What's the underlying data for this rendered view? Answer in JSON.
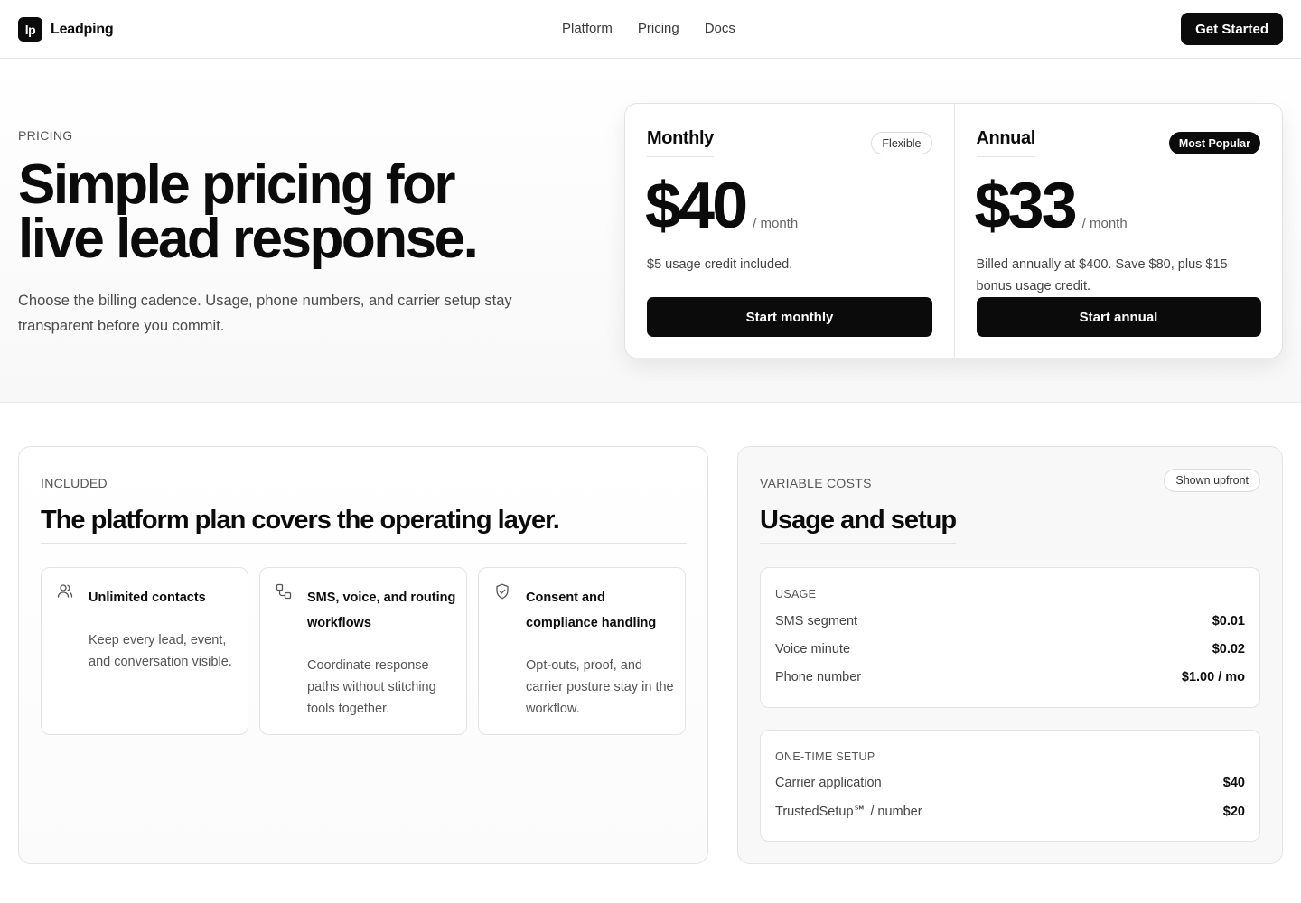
{
  "brand": {
    "logo_mark": "lp",
    "name": "Leadping"
  },
  "nav": {
    "items": [
      "Platform",
      "Pricing",
      "Docs"
    ],
    "cta": "Get Started"
  },
  "hero": {
    "eyebrow": "PRICING",
    "title_line1": "Simple pricing for",
    "title_line2": "live lead response.",
    "subtitle": "Choose the billing cadence. Usage, phone numbers, and carrier setup stay transparent before you commit."
  },
  "plans": [
    {
      "name": "Monthly",
      "badge": "Flexible",
      "price": "$40",
      "period": "/ month",
      "note": "$5 usage credit included.",
      "cta": "Start monthly"
    },
    {
      "name": "Annual",
      "badge": "Most Popular",
      "price": "$33",
      "period": "/ month",
      "note": "Billed annually at $400. Save $80, plus $15 bonus usage credit.",
      "cta": "Start annual"
    }
  ],
  "included": {
    "eyebrow": "INCLUDED",
    "title": "The platform plan covers the operating layer.",
    "features": [
      {
        "icon": "users-icon",
        "title": "Unlimited contacts",
        "desc": "Keep every lead, event, and conversation visible."
      },
      {
        "icon": "workflow-icon",
        "title": "SMS, voice, and routing workflows",
        "desc": "Coordinate response paths without stitching tools together."
      },
      {
        "icon": "shield-check-icon",
        "title": "Consent and compliance handling",
        "desc": "Opt-outs, proof, and carrier posture stay in the workflow."
      }
    ]
  },
  "costs": {
    "eyebrow": "VARIABLE COSTS",
    "badge": "Shown upfront",
    "title": "Usage and setup",
    "usage": {
      "label": "USAGE",
      "rows": [
        {
          "name": "SMS segment",
          "value": "$0.01"
        },
        {
          "name": "Voice minute",
          "value": "$0.02"
        },
        {
          "name": "Phone number",
          "value": "$1.00 / mo"
        }
      ]
    },
    "setup": {
      "label": "ONE-TIME SETUP",
      "rows": [
        {
          "name": "Carrier application",
          "value": "$40"
        },
        {
          "name": "TrustedSetup℠ / number",
          "value": "$20"
        }
      ]
    }
  }
}
